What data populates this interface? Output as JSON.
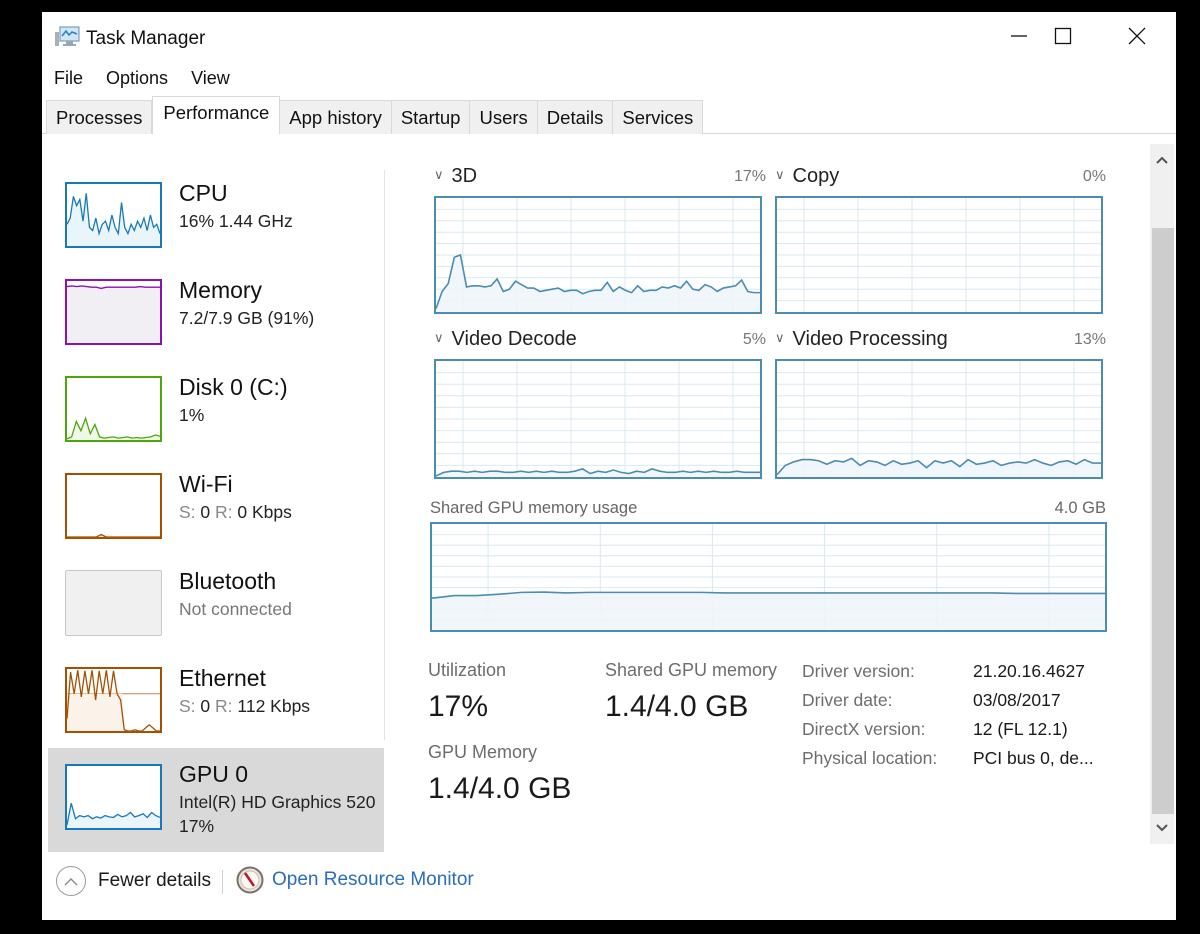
{
  "window": {
    "title": "Task Manager",
    "controls": {
      "minimize": "minimize",
      "maximize": "maximize",
      "close": "close"
    }
  },
  "menu": [
    "File",
    "Options",
    "View"
  ],
  "tabs": [
    {
      "label": "Processes",
      "active": false
    },
    {
      "label": "Performance",
      "active": true
    },
    {
      "label": "App history",
      "active": false
    },
    {
      "label": "Startup",
      "active": false
    },
    {
      "label": "Users",
      "active": false
    },
    {
      "label": "Details",
      "active": false
    },
    {
      "label": "Services",
      "active": false
    }
  ],
  "sidebar": {
    "items": [
      {
        "id": "cpu",
        "title": "CPU",
        "subtitle": "16% 1.44 GHz",
        "color": "#1779ba",
        "fill": "#eaf4fb"
      },
      {
        "id": "memory",
        "title": "Memory",
        "subtitle": "7.2/7.9 GB (91%)",
        "color": "#8b12ae",
        "fill": "#f1eef4"
      },
      {
        "id": "disk",
        "title": "Disk 0 (C:)",
        "subtitle": "1%",
        "color": "#4da60c",
        "fill": "#eff7e9"
      },
      {
        "id": "wifi",
        "title": "Wi-Fi",
        "send_label": "S:",
        "send_value": "0",
        "recv_label": "R:",
        "recv_value": "0 Kbps",
        "color": "#a74f01",
        "fill": "#fbf2ea"
      },
      {
        "id": "bluetooth",
        "title": "Bluetooth",
        "subtitle": "Not connected",
        "color": "#c8c8c8",
        "fill": "#f0f0f0"
      },
      {
        "id": "ethernet",
        "title": "Ethernet",
        "send_label": "S:",
        "send_value": "0",
        "recv_label": "R:",
        "recv_value": "112 Kbps",
        "color": "#a74f01",
        "fill": "#fbf2ea"
      },
      {
        "id": "gpu",
        "title": "GPU 0",
        "subtitle": "Intel(R) HD Graphics 520",
        "subtitle2": "17%",
        "color": "#1779ba",
        "fill": "#eaf4fb",
        "selected": true
      }
    ]
  },
  "gpu_engines": [
    {
      "name": "3D",
      "percent": "17%"
    },
    {
      "name": "Copy",
      "percent": "0%"
    },
    {
      "name": "Video Decode",
      "percent": "5%"
    },
    {
      "name": "Video Processing",
      "percent": "13%"
    }
  ],
  "shared_memory": {
    "label": "Shared GPU memory usage",
    "max": "4.0 GB"
  },
  "stats": {
    "utilization_label": "Utilization",
    "utilization_value": "17%",
    "shared_label": "Shared GPU memory",
    "shared_value": "1.4/4.0 GB",
    "gpu_memory_label": "GPU Memory",
    "gpu_memory_value": "1.4/4.0 GB"
  },
  "info": [
    {
      "label": "Driver version:",
      "value": "21.20.16.4627"
    },
    {
      "label": "Driver date:",
      "value": "03/08/2017"
    },
    {
      "label": "DirectX version:",
      "value": "12 (FL 12.1)"
    },
    {
      "label": "Physical location:",
      "value": "PCI bus 0, de..."
    }
  ],
  "footer": {
    "fewer_details": "Fewer details",
    "resource_monitor": "Open Resource Monitor"
  },
  "colors": {
    "graph_line": "#4a8db0",
    "graph_grid": "#d9e8f0",
    "graph_fill": "#eef5fa",
    "link": "#2a6ebb",
    "selected_bg": "#d9d9d9"
  },
  "chart_data": [
    {
      "type": "area",
      "name": "3D",
      "ylim": [
        0,
        100
      ],
      "values": [
        3,
        18,
        25,
        48,
        50,
        22,
        23,
        23,
        22,
        23,
        29,
        18,
        20,
        27,
        24,
        21,
        21,
        18,
        19,
        20,
        21,
        18,
        19,
        19,
        16,
        18,
        19,
        19,
        26,
        18,
        22,
        19,
        17,
        23,
        18,
        19,
        19,
        22,
        21,
        23,
        21,
        27,
        20,
        19,
        24,
        22,
        18,
        21,
        22,
        23,
        28,
        18,
        17,
        17
      ]
    },
    {
      "type": "area",
      "name": "Copy",
      "ylim": [
        0,
        100
      ],
      "values": [
        0,
        0,
        0,
        0,
        0,
        0,
        0,
        0,
        0,
        0
      ]
    },
    {
      "type": "area",
      "name": "Video Decode",
      "ylim": [
        0,
        100
      ],
      "values": [
        1,
        4,
        5,
        5,
        4,
        5,
        4,
        5,
        5,
        4,
        4,
        5,
        4,
        5,
        4,
        5,
        4,
        4,
        5,
        7,
        3,
        5,
        4,
        6,
        4,
        3,
        5,
        4,
        7,
        5,
        4,
        4,
        5,
        4,
        5,
        4,
        5,
        4,
        4,
        5,
        4,
        4,
        4
      ]
    },
    {
      "type": "area",
      "name": "Video Processing",
      "ylim": [
        0,
        100
      ],
      "values": [
        2,
        10,
        13,
        15,
        15,
        14,
        11,
        14,
        13,
        16,
        10,
        14,
        13,
        10,
        14,
        11,
        12,
        14,
        8,
        14,
        12,
        14,
        9,
        15,
        11,
        12,
        14,
        10,
        12,
        13,
        12,
        15,
        12,
        10,
        13,
        14,
        11,
        15,
        12,
        12
      ]
    },
    {
      "type": "area",
      "name": "Shared GPU memory usage",
      "ylim": [
        0,
        4.0
      ],
      "unit": "GB",
      "values": [
        1.2,
        1.3,
        1.3,
        1.35,
        1.42,
        1.43,
        1.4,
        1.42,
        1.42,
        1.42,
        1.42,
        1.42,
        1.42,
        1.4,
        1.4,
        1.4,
        1.4,
        1.4,
        1.4,
        1.4,
        1.4,
        1.4,
        1.4,
        1.4,
        1.4,
        1.4,
        1.38,
        1.38,
        1.38,
        1.38,
        1.38
      ]
    }
  ],
  "sparklines": {
    "cpu": [
      35,
      45,
      80,
      65,
      75,
      40,
      85,
      30,
      25,
      45,
      20,
      35,
      40,
      25,
      50,
      30,
      20,
      70,
      30,
      20,
      35,
      25,
      40,
      30,
      45,
      25,
      50,
      30,
      35,
      20
    ],
    "memory": [
      91,
      92,
      91,
      92,
      91,
      90,
      90,
      88,
      90,
      90,
      90,
      90,
      90,
      90,
      90,
      91,
      90,
      90,
      90,
      90
    ],
    "disk": [
      2,
      5,
      30,
      15,
      35,
      10,
      25,
      5,
      3,
      4,
      5,
      3,
      4,
      5,
      3,
      4,
      3,
      4,
      5,
      8,
      6
    ],
    "wifi": [
      0,
      0,
      0,
      0,
      0,
      0,
      0,
      4,
      0,
      0,
      0,
      0,
      0,
      0,
      0,
      0,
      0,
      0,
      0,
      0
    ],
    "ethernet": [
      20,
      95,
      60,
      98,
      55,
      97,
      60,
      98,
      50,
      97,
      60,
      98,
      55,
      97,
      60,
      50,
      2,
      0,
      0,
      2,
      0,
      0,
      5,
      10,
      5,
      0,
      0
    ],
    "gpu": [
      5,
      40,
      15,
      20,
      18,
      20,
      15,
      18,
      16,
      20,
      18,
      17,
      22,
      18,
      20,
      25,
      18,
      20,
      23,
      17,
      25,
      20,
      17
    ]
  }
}
